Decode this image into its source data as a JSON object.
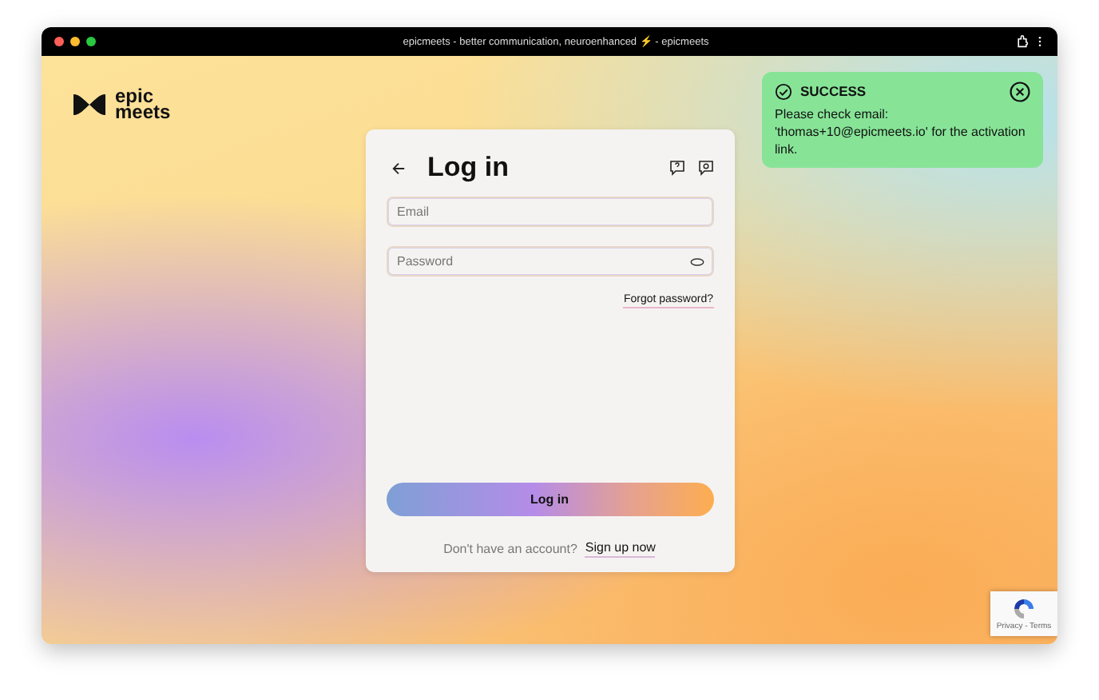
{
  "window": {
    "title": "epicmeets - better communication, neuroenhanced ⚡ - epicmeets"
  },
  "logo": {
    "line_1": "epic",
    "line_2": "meets"
  },
  "toast": {
    "title": "SUCCESS",
    "message": "Please check email: 'thomas+10@epicmeets.io' for the activation link."
  },
  "login": {
    "title": "Log in",
    "email": {
      "placeholder": "Email"
    },
    "password": {
      "placeholder": "Password"
    },
    "forgot_link": "Forgot password?",
    "submit": "Log in",
    "signup_prompt": "Don't have an account?",
    "signup_link": "Sign up now"
  },
  "recaptcha": {
    "footer": "Privacy - Terms"
  }
}
